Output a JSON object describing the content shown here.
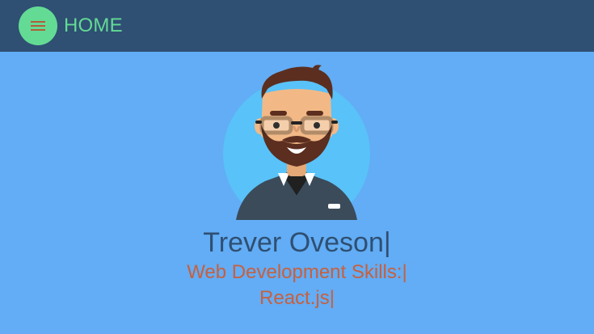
{
  "header": {
    "title": "HOME",
    "menu_icon": "hamburger-icon",
    "colors": {
      "bar": "#2f4f73",
      "accent": "#63db94"
    }
  },
  "profile": {
    "name": "Trever Oveson",
    "skills_heading": "Web Development Skills:",
    "current_skill": "React.js",
    "cursor": "|",
    "colors": {
      "background": "#62adf5",
      "name": "#2f4f73",
      "skills": "#c7603f"
    }
  }
}
